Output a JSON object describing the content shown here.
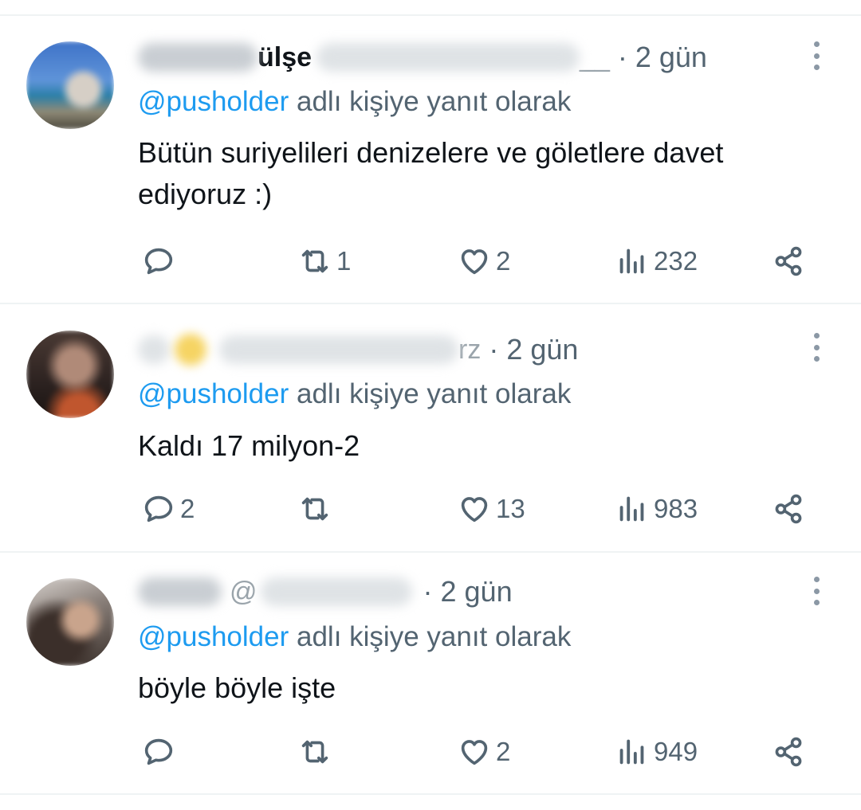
{
  "reply_prefix_mention": "@pusholder",
  "reply_prefix_suffix": "adlı kişiye yanıt olarak",
  "tweets": [
    {
      "name_visible": "ülşe",
      "handle_visible": "__",
      "time": "· 2 gün",
      "text_line1": "Bütün suriyelileri denizelere ve göletlere davet",
      "text_line2": "ediyoruz :)",
      "replies": "",
      "retweets": "1",
      "likes": "2",
      "views": "232"
    },
    {
      "name_visible": "",
      "handle_visible": "rz",
      "time": "· 2 gün",
      "text_line1": "Kaldı 17 milyon-2",
      "text_line2": "",
      "replies": "2",
      "retweets": "",
      "likes": "13",
      "views": "983"
    },
    {
      "name_visible": "",
      "handle_visible": "@",
      "time": "· 2 gün",
      "text_line1": "böyle böyle işte",
      "text_line2": "",
      "replies": "",
      "retweets": "",
      "likes": "2",
      "views": "949"
    }
  ],
  "icons": {
    "reply": "reply-icon",
    "retweet": "retweet-icon",
    "like": "heart-icon",
    "views": "views-icon",
    "share": "share-icon",
    "more": "more-dots-icon"
  },
  "colors": {
    "mention": "#1d9bf0",
    "secondary_text": "#536471",
    "primary_text": "#0f1419",
    "divider": "#eff3f4"
  }
}
